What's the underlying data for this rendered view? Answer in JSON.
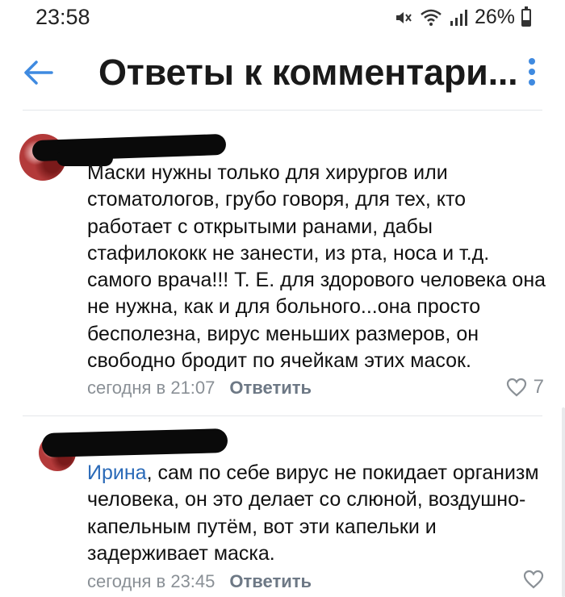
{
  "status_bar": {
    "time": "23:58",
    "battery": "26%",
    "icons": [
      "mute-icon",
      "wifi-icon",
      "signal-icon",
      "battery-icon"
    ]
  },
  "header": {
    "title": "Ответы к комментари...",
    "back_icon": "arrow-left-icon",
    "menu_icon": "more-vertical-icon"
  },
  "comments": [
    {
      "reply_to": "",
      "text": "Маски нужны только для хирургов или стоматологов, грубо говоря, для тех, кто работает с открытыми ранами, дабы стафилококк не занести, из рта, носа и т.д. самого врача!!! Т. Е. для здорового человека она не нужна, как и для больного...она просто бесполезна, вирус меньших размеров, он свободно бродит по ячейкам этих масок.",
      "time": "сегодня в 21:07",
      "reply_label": "Ответить",
      "likes": "7"
    },
    {
      "reply_to": "Ирина",
      "text": ", сам по себе вирус не покидает организм человека, он это делает со слюной, воздушно-капельным путём, вот эти капельки и задерживает маска.",
      "time": "сегодня в 23:45",
      "reply_label": "Ответить",
      "likes": ""
    }
  ],
  "colors": {
    "accent": "#3f8ae0",
    "link": "#2a6ab8",
    "meta": "#8a9096"
  }
}
